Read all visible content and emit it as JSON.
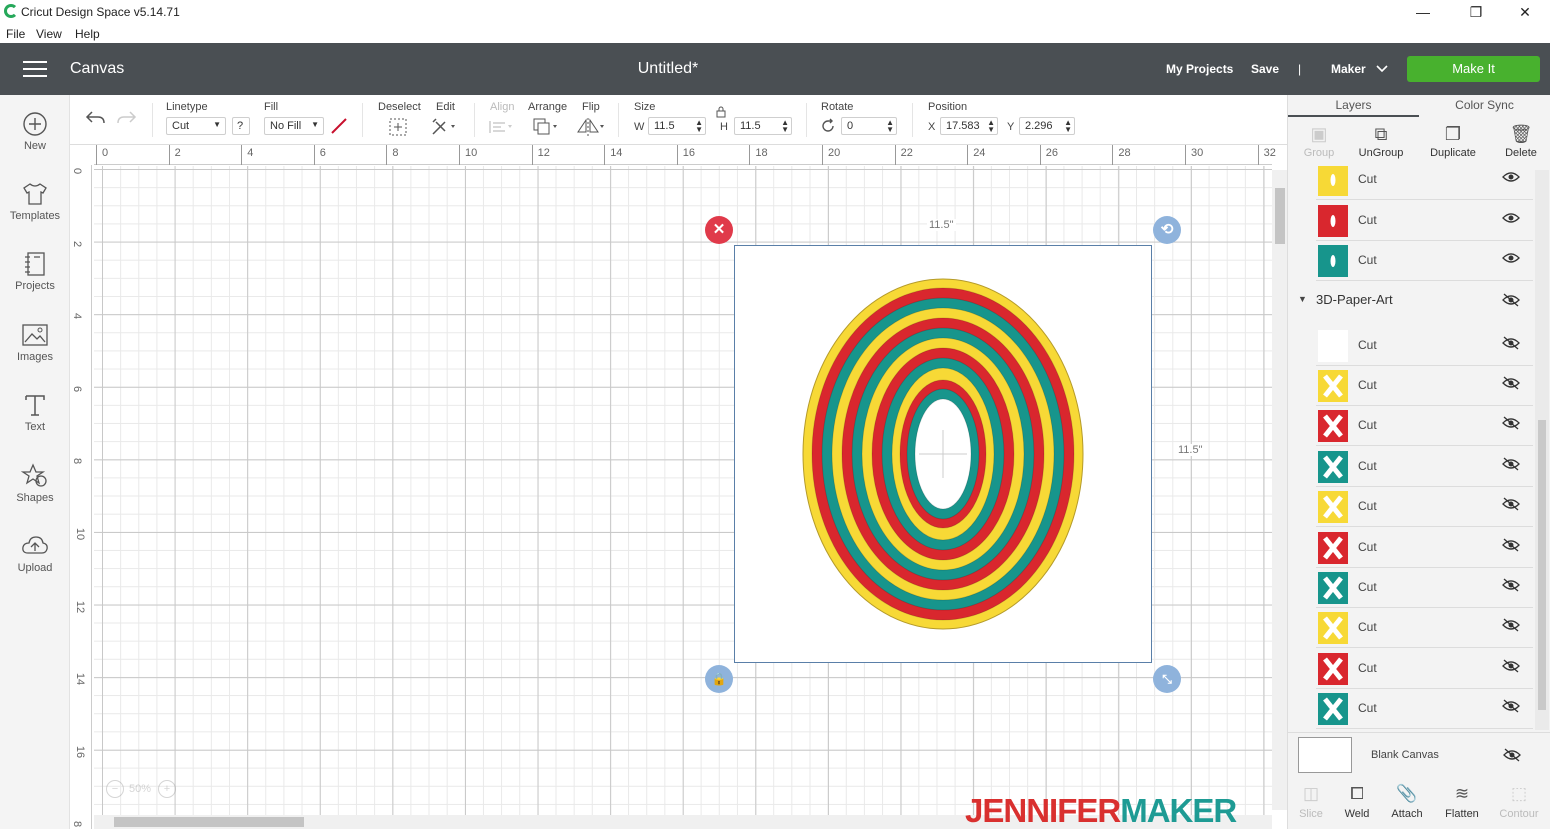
{
  "window": {
    "title": "Cricut Design Space  v5.14.71",
    "minimize": "—",
    "restore": "❐",
    "close": "✕"
  },
  "menu": [
    "File",
    "View",
    "Help"
  ],
  "header": {
    "section": "Canvas",
    "doc_title": "Untitled*",
    "my_projects": "My Projects",
    "save": "Save",
    "divider": "|",
    "machine": "Maker",
    "make_it": "Make It"
  },
  "sidebar": [
    {
      "label": "New",
      "icon": "plus-circle-icon"
    },
    {
      "label": "Templates",
      "icon": "tshirt-icon"
    },
    {
      "label": "Projects",
      "icon": "notebook-icon"
    },
    {
      "label": "Images",
      "icon": "image-icon"
    },
    {
      "label": "Text",
      "icon": "text-t-icon"
    },
    {
      "label": "Shapes",
      "icon": "shapes-icon"
    },
    {
      "label": "Upload",
      "icon": "cloud-upload-icon"
    }
  ],
  "toolbar": {
    "linetype_label": "Linetype",
    "linetype_value": "Cut",
    "help": "?",
    "fill_label": "Fill",
    "fill_value": "No Fill",
    "deselect_label": "Deselect",
    "edit_label": "Edit",
    "align_label": "Align",
    "arrange_label": "Arrange",
    "flip_label": "Flip",
    "size_label": "Size",
    "w_label": "W",
    "w_value": "11.5",
    "h_label": "H",
    "h_value": "11.5",
    "rotate_label": "Rotate",
    "rotate_value": "0",
    "position_label": "Position",
    "x_label": "X",
    "x_value": "17.583",
    "y_label": "Y",
    "y_value": "2.296"
  },
  "ruler": {
    "top": [
      "0",
      "2",
      "4",
      "6",
      "8",
      "10",
      "12",
      "14",
      "16",
      "18",
      "20",
      "22",
      "24",
      "26",
      "28",
      "30",
      "32"
    ],
    "left": [
      "0",
      "2",
      "4",
      "6",
      "8",
      "10",
      "12",
      "14",
      "16",
      "8"
    ]
  },
  "selection": {
    "width_label": "11.5\"",
    "height_label": "11.5\""
  },
  "zoom": {
    "minus": "−",
    "value": "50%",
    "plus": "+"
  },
  "brand": {
    "part1": "JENNIFER",
    "part2": "MAKER"
  },
  "colors": {
    "yellow": "#f7d936",
    "red": "#d9272e",
    "teal": "#17958c",
    "accent_green": "#48b12e",
    "header": "#4a4f53"
  },
  "right_panel": {
    "tabs": [
      "Layers",
      "Color Sync"
    ],
    "top_actions": [
      {
        "label": "Group",
        "enabled": false
      },
      {
        "label": "UnGroup",
        "enabled": true
      },
      {
        "label": "Duplicate",
        "enabled": true
      },
      {
        "label": "Delete",
        "enabled": true
      }
    ],
    "upper_layers": [
      {
        "name": "Cut",
        "color": "#f7d936",
        "visible": true
      },
      {
        "name": "Cut",
        "color": "#d9272e",
        "visible": true
      },
      {
        "name": "Cut",
        "color": "#17958c",
        "visible": true
      }
    ],
    "group_name": "3D-Paper-Art",
    "group_layers": [
      {
        "name": "Cut",
        "color": "#ffffff",
        "visible": false
      },
      {
        "name": "Cut",
        "color": "#f7d936",
        "visible": false
      },
      {
        "name": "Cut",
        "color": "#d9272e",
        "visible": false
      },
      {
        "name": "Cut",
        "color": "#17958c",
        "visible": false
      },
      {
        "name": "Cut",
        "color": "#f7d936",
        "visible": false
      },
      {
        "name": "Cut",
        "color": "#d9272e",
        "visible": false
      },
      {
        "name": "Cut",
        "color": "#17958c",
        "visible": false
      },
      {
        "name": "Cut",
        "color": "#f7d936",
        "visible": false
      },
      {
        "name": "Cut",
        "color": "#d9272e",
        "visible": false
      },
      {
        "name": "Cut",
        "color": "#17958c",
        "visible": false
      }
    ],
    "blank_canvas": "Blank Canvas",
    "bottom_actions": [
      {
        "label": "Slice",
        "enabled": false
      },
      {
        "label": "Weld",
        "enabled": true
      },
      {
        "label": "Attach",
        "enabled": true
      },
      {
        "label": "Flatten",
        "enabled": true
      },
      {
        "label": "Contour",
        "enabled": false
      }
    ]
  }
}
